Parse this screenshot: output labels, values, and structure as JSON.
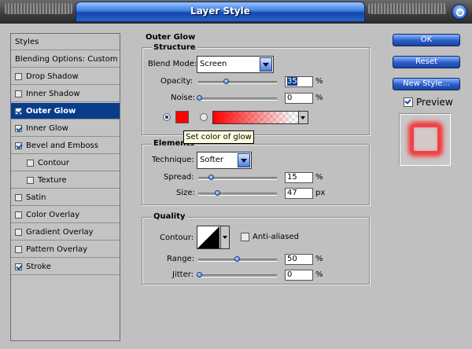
{
  "window": {
    "title": "Layer Style"
  },
  "styles_panel": {
    "items": [
      {
        "label": "Styles",
        "checkbox": false,
        "checked": false,
        "selected": false
      },
      {
        "label": "Blending Options: Custom",
        "checkbox": false,
        "checked": false,
        "selected": false
      },
      {
        "label": "Drop Shadow",
        "checkbox": true,
        "checked": false,
        "selected": false
      },
      {
        "label": "Inner Shadow",
        "checkbox": true,
        "checked": false,
        "selected": false
      },
      {
        "label": "Outer Glow",
        "checkbox": true,
        "checked": true,
        "selected": true
      },
      {
        "label": "Inner Glow",
        "checkbox": true,
        "checked": true,
        "selected": false
      },
      {
        "label": "Bevel and Emboss",
        "checkbox": true,
        "checked": true,
        "selected": false
      },
      {
        "label": "Contour",
        "checkbox": true,
        "checked": false,
        "selected": false
      },
      {
        "label": "Texture",
        "checkbox": true,
        "checked": false,
        "selected": false
      },
      {
        "label": "Satin",
        "checkbox": true,
        "checked": false,
        "selected": false
      },
      {
        "label": "Color Overlay",
        "checkbox": true,
        "checked": false,
        "selected": false
      },
      {
        "label": "Gradient Overlay",
        "checkbox": true,
        "checked": false,
        "selected": false
      },
      {
        "label": "Pattern Overlay",
        "checkbox": true,
        "checked": false,
        "selected": false
      },
      {
        "label": "Stroke",
        "checkbox": true,
        "checked": true,
        "selected": false
      }
    ]
  },
  "outer_glow": {
    "title": "Outer Glow",
    "structure": {
      "title": "Structure",
      "blend_mode_label": "Blend Mode:",
      "blend_mode_value": "Screen",
      "opacity_label": "Opacity:",
      "opacity_value": "35",
      "noise_label": "Noise:",
      "noise_value": "0",
      "percent": "%",
      "glow_color": "#ff0000",
      "solid_color_selected": true
    },
    "elements": {
      "title": "Elements",
      "technique_label": "Technique:",
      "technique_value": "Softer",
      "spread_label": "Spread:",
      "spread_value": "15",
      "size_label": "Size:",
      "size_value": "47",
      "percent": "%",
      "px": "px"
    },
    "quality": {
      "title": "Quality",
      "contour_label": "Contour:",
      "anti_aliased_label": "Anti-aliased",
      "anti_aliased_checked": false,
      "range_label": "Range:",
      "range_value": "50",
      "jitter_label": "Jitter:",
      "jitter_value": "0",
      "percent": "%"
    }
  },
  "tooltip": "Set color of glow",
  "buttons": {
    "ok": "OK",
    "reset": "Reset",
    "new_style": "New Style..."
  },
  "preview": {
    "label": "Preview",
    "checked": true
  },
  "colors": {
    "accent": "#0a3c8c",
    "glow": "#ff0000",
    "panel": "#c0c0c0"
  }
}
